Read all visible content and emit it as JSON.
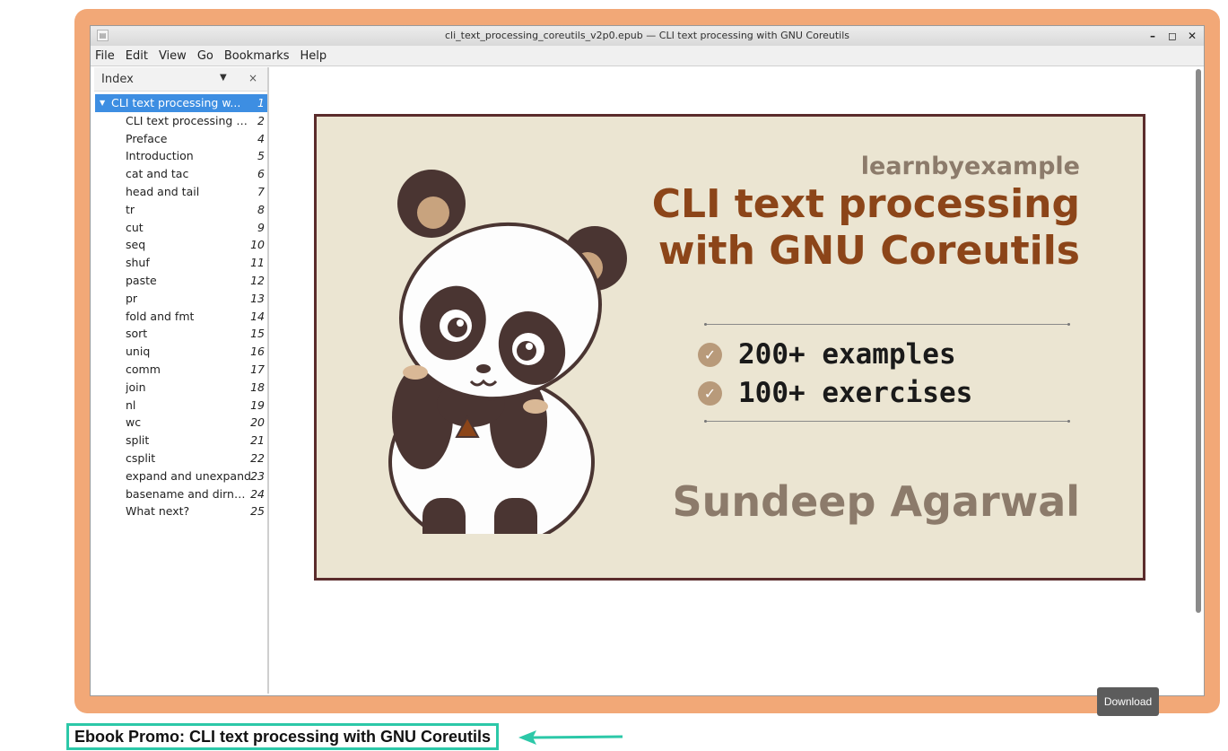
{
  "window": {
    "title": "cli_text_processing_coreutils_v2p0.epub — CLI text processing with GNU Coreutils",
    "controls": [
      "–",
      "◻",
      "✕"
    ]
  },
  "menu": [
    "File",
    "Edit",
    "View",
    "Go",
    "Bookmarks",
    "Help"
  ],
  "sidebar": {
    "header": "Index",
    "items": [
      {
        "name": "CLI text processing w...",
        "page": "1",
        "selected": true
      },
      {
        "name": "CLI text processing w...",
        "page": "2"
      },
      {
        "name": "Preface",
        "page": "4"
      },
      {
        "name": "Introduction",
        "page": "5"
      },
      {
        "name": "cat and tac",
        "page": "6"
      },
      {
        "name": "head and tail",
        "page": "7"
      },
      {
        "name": "tr",
        "page": "8"
      },
      {
        "name": "cut",
        "page": "9"
      },
      {
        "name": "seq",
        "page": "10"
      },
      {
        "name": "shuf",
        "page": "11"
      },
      {
        "name": "paste",
        "page": "12"
      },
      {
        "name": "pr",
        "page": "13"
      },
      {
        "name": "fold and fmt",
        "page": "14"
      },
      {
        "name": "sort",
        "page": "15"
      },
      {
        "name": "uniq",
        "page": "16"
      },
      {
        "name": "comm",
        "page": "17"
      },
      {
        "name": "join",
        "page": "18"
      },
      {
        "name": "nl",
        "page": "19"
      },
      {
        "name": "wc",
        "page": "20"
      },
      {
        "name": "split",
        "page": "21"
      },
      {
        "name": "csplit",
        "page": "22"
      },
      {
        "name": "expand and unexpand",
        "page": "23"
      },
      {
        "name": "basename and dirname",
        "page": "24"
      },
      {
        "name": "What next?",
        "page": "25"
      }
    ]
  },
  "cover": {
    "brand": "learnbyexample",
    "title_line1": "CLI text processing",
    "title_line2": "with GNU Coreutils",
    "feature1": "200+ examples",
    "feature2": "100+ exercises",
    "author": "Sundeep Agarwal"
  },
  "download_label": "Download",
  "caption": "Ebook Promo: CLI text processing with GNU Coreutils",
  "colors": {
    "frame": "#f2a877",
    "caption_border": "#2cc8a8",
    "selection": "#3d8ee2"
  }
}
